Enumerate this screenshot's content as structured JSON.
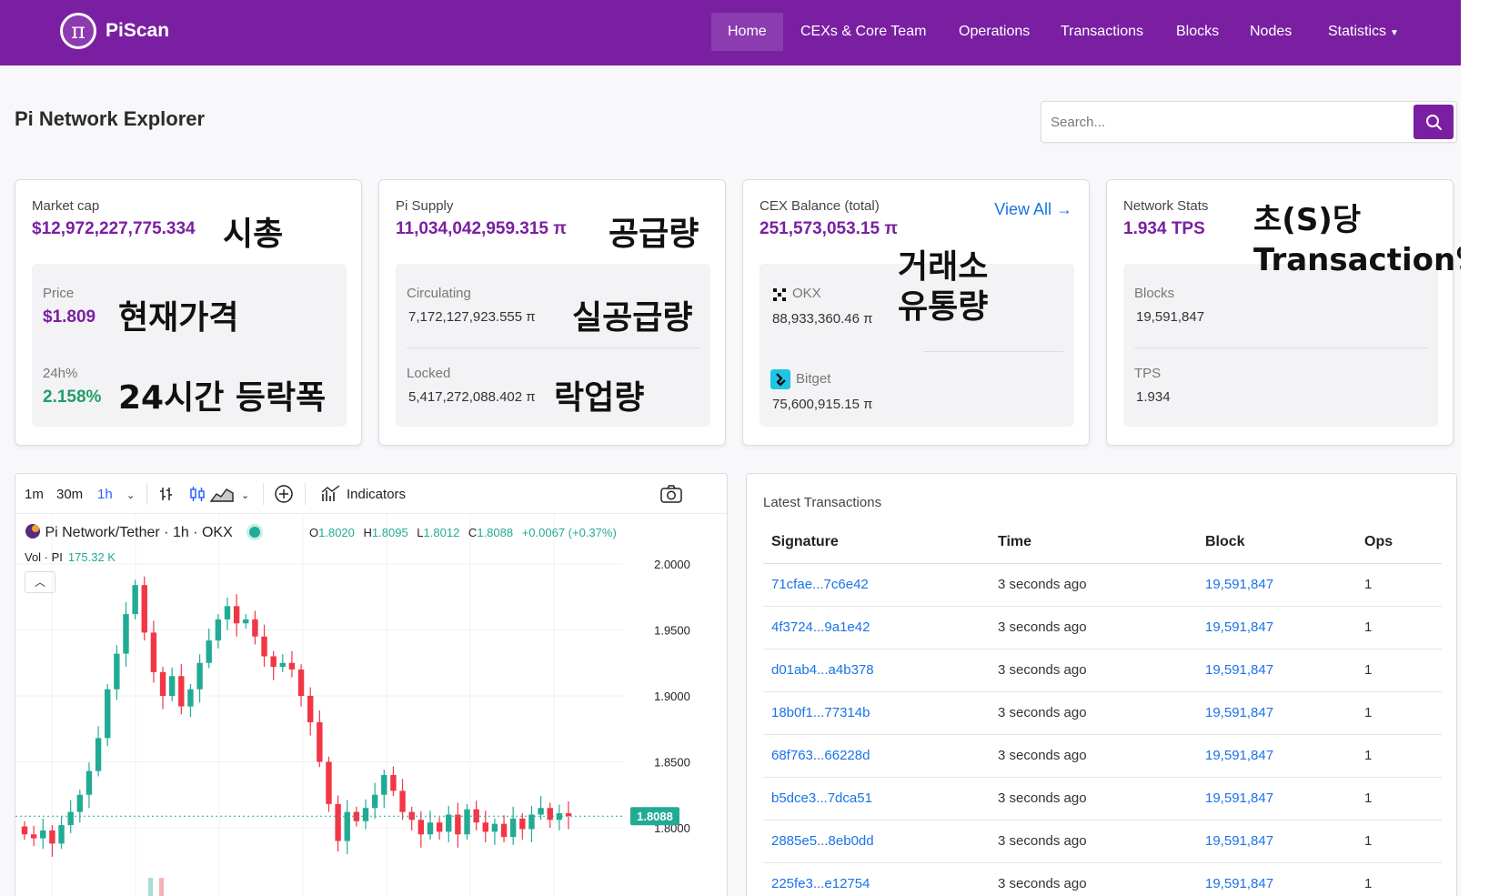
{
  "navbar": {
    "brand": "PiScan",
    "logo_glyph": "π",
    "items": [
      {
        "label": "Home"
      },
      {
        "label": "CEXs & Core Team"
      },
      {
        "label": "Operations"
      },
      {
        "label": "Transactions"
      },
      {
        "label": "Blocks"
      },
      {
        "label": "Nodes"
      },
      {
        "label": "Statistics"
      }
    ]
  },
  "page": {
    "title": "Pi Network Explorer",
    "search_placeholder": "Search..."
  },
  "cards": {
    "market": {
      "label": "Market cap",
      "value": "$12,972,227,775.334",
      "price_label": "Price",
      "price_value": "$1.809",
      "change_label": "24h%",
      "change_value": "2.158%"
    },
    "supply": {
      "label": "Pi Supply",
      "value": "11,034,042,959.315 π",
      "circulating_label": "Circulating",
      "circulating_value": "7,172,127,923.555 π",
      "locked_label": "Locked",
      "locked_value": "5,417,272,088.402 π"
    },
    "cex": {
      "label": "CEX Balance (total)",
      "value": "251,573,053.15 π",
      "view_all": "View All →",
      "okx_label": "OKX",
      "okx_value": "88,933,360.46 π",
      "bitget_label": "Bitget",
      "bitget_value": "75,600,915.15 π"
    },
    "network": {
      "label": "Network Stats",
      "value": "1.934 TPS",
      "blocks_label": "Blocks",
      "blocks_value": "19,591,847",
      "tps_label": "TPS",
      "tps_value": "1.934"
    }
  },
  "annotations": {
    "market_cap": "시총",
    "price": "현재가격",
    "change": "24시간 등락폭",
    "supply": "공급량",
    "circulating": "실공급량",
    "locked": "락업량",
    "cex_line1": "거래소",
    "cex_line2": "유통량",
    "tps_line1": "초(S)당",
    "tps_line2": "Transaction양"
  },
  "chart_toolbar": {
    "intervals": [
      "1m",
      "30m",
      "1h"
    ],
    "active_interval": "1h",
    "indicators_label": "Indicators"
  },
  "chart_legend": {
    "symbol": "Pi Network/Tether · 1h · OKX",
    "o_label": "O",
    "o": "1.8020",
    "h_label": "H",
    "h": "1.8095",
    "l_label": "L",
    "l": "1.8012",
    "c_label": "C",
    "c": "1.8088",
    "change": "+0.0067 (+0.37%)",
    "vol_label": "Vol · PI",
    "vol_value": "175.32 K"
  },
  "colors": {
    "brand": "#7a1fa2",
    "up": "#22ab94",
    "down": "#f23645",
    "link": "#1a73e8"
  },
  "chart_data": {
    "type": "candlestick",
    "title": "Pi Network/Tether · 1h · OKX",
    "y_ticks": [
      "2.0000",
      "1.9500",
      "1.9000",
      "1.8500",
      "1.8000"
    ],
    "ylim": [
      1.78,
      2.02
    ],
    "last_price": "1.8088",
    "closes": [
      1.795,
      1.792,
      1.798,
      1.788,
      1.802,
      1.812,
      1.825,
      1.843,
      1.868,
      1.905,
      1.932,
      1.962,
      1.984,
      1.948,
      1.918,
      1.9,
      1.915,
      1.892,
      1.905,
      1.925,
      1.942,
      1.958,
      1.968,
      1.955,
      1.958,
      1.945,
      1.93,
      1.922,
      1.925,
      1.92,
      1.9,
      1.88,
      1.85,
      1.818,
      1.79,
      1.812,
      1.805,
      1.815,
      1.825,
      1.84,
      1.828,
      1.812,
      1.806,
      1.795,
      1.804,
      1.797,
      1.81,
      1.795,
      1.814,
      1.804,
      1.797,
      1.803,
      1.793,
      1.807,
      1.799,
      1.81,
      1.815,
      1.806,
      1.811,
      1.809
    ],
    "grid": true
  },
  "transactions": {
    "title": "Latest Transactions",
    "columns": [
      "Signature",
      "Time",
      "Block",
      "Ops"
    ],
    "rows": [
      [
        "71cfae...7c6e42",
        "3 seconds ago",
        "19,591,847",
        "1"
      ],
      [
        "4f3724...9a1e42",
        "3 seconds ago",
        "19,591,847",
        "1"
      ],
      [
        "d01ab4...a4b378",
        "3 seconds ago",
        "19,591,847",
        "1"
      ],
      [
        "18b0f1...77314b",
        "3 seconds ago",
        "19,591,847",
        "1"
      ],
      [
        "68f763...66228d",
        "3 seconds ago",
        "19,591,847",
        "1"
      ],
      [
        "b5dce3...7dca51",
        "3 seconds ago",
        "19,591,847",
        "1"
      ],
      [
        "2885e5...8eb0dd",
        "3 seconds ago",
        "19,591,847",
        "1"
      ],
      [
        "225fe3...e12754",
        "3 seconds ago",
        "19,591,847",
        "1"
      ]
    ]
  }
}
